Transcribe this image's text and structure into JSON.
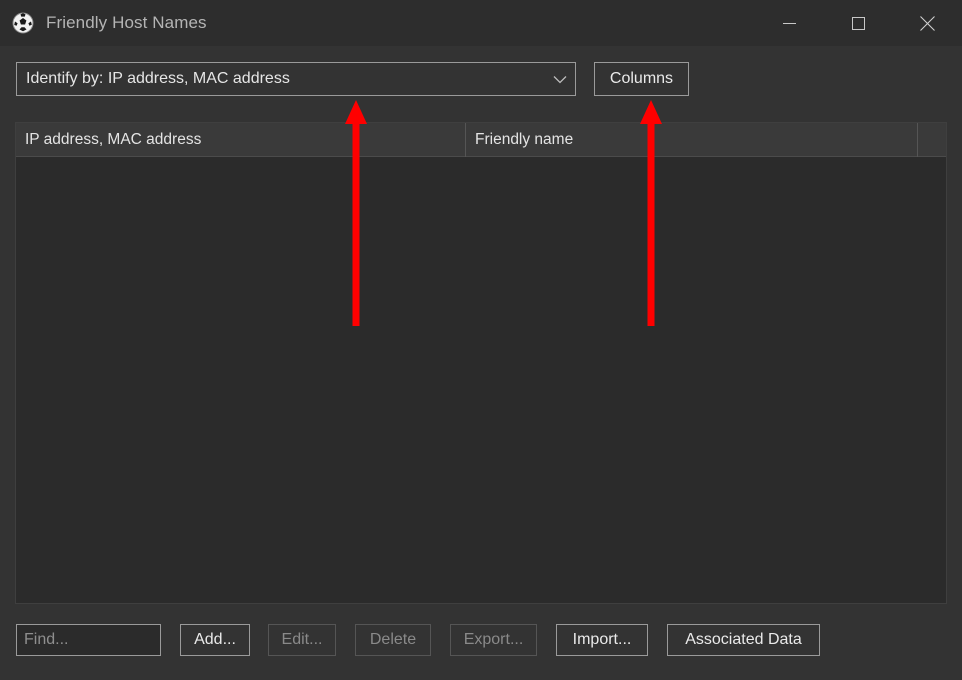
{
  "window": {
    "title": "Friendly Host Names",
    "icon": "soccer-ball-icon",
    "caption": {
      "minimize": "minimize-icon",
      "maximize": "maximize-icon",
      "close": "close-icon"
    }
  },
  "toolbar": {
    "identify_combo": {
      "value": "Identify by: IP address, MAC address",
      "arrow_icon": "chevron-down-icon"
    },
    "columns_label": "Columns"
  },
  "table": {
    "columns": [
      {
        "label": "IP address, MAC address"
      },
      {
        "label": "Friendly name"
      },
      {
        "label": ""
      }
    ],
    "rows": []
  },
  "bottom_bar": {
    "find_placeholder": "Find...",
    "find_value": "",
    "buttons": [
      {
        "label": "Add...",
        "enabled": true
      },
      {
        "label": "Edit...",
        "enabled": false
      },
      {
        "label": "Delete",
        "enabled": false
      },
      {
        "label": "Export...",
        "enabled": false
      },
      {
        "label": "Import...",
        "enabled": true
      },
      {
        "label": "Associated Data",
        "enabled": true
      }
    ]
  },
  "annotations": {
    "color": "#ff0000",
    "arrows": [
      {
        "name": "arrow-to-identify-combo",
        "direction": "up"
      },
      {
        "name": "arrow-to-columns-button",
        "direction": "up"
      }
    ]
  }
}
